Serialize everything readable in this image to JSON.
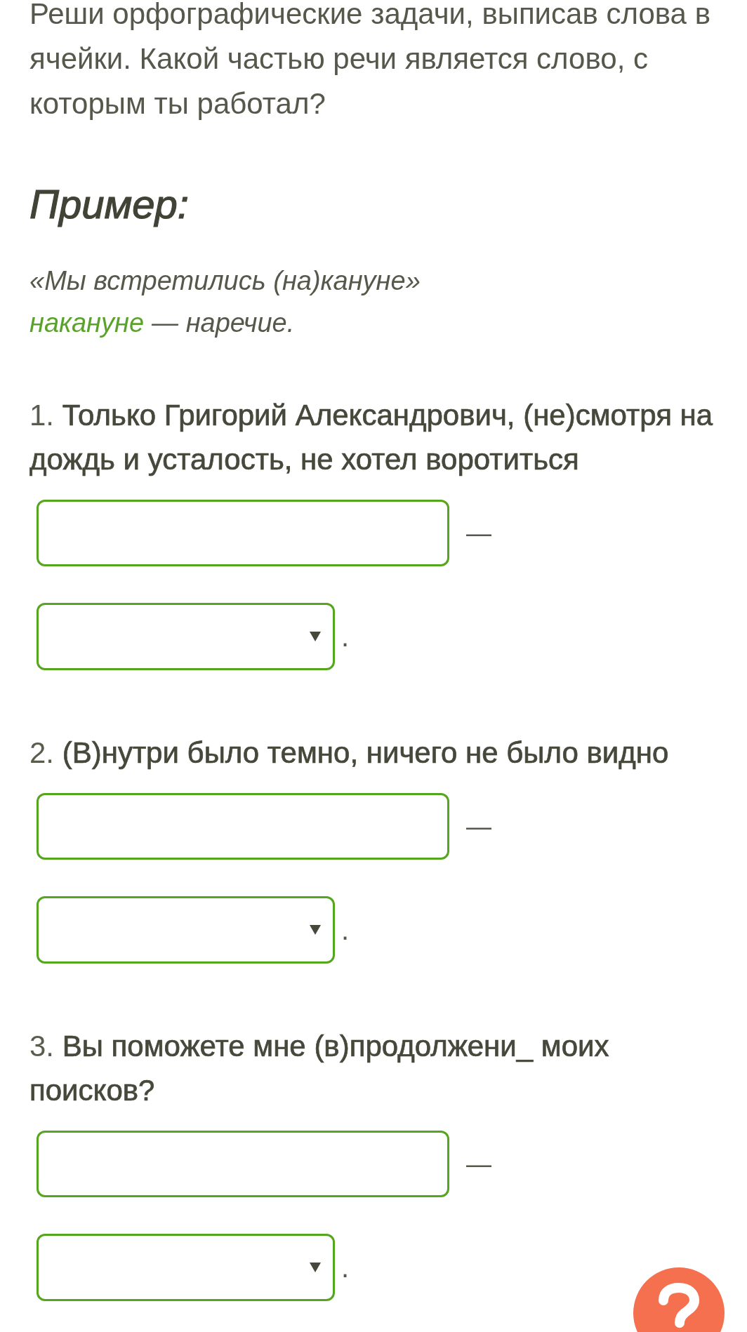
{
  "instructions": "Реши орфографические задачи, выписав слова в ячейки. Какой частью речи является слово, с которым ты работал?",
  "example": {
    "heading": "Пример:",
    "sentence": "«Мы встретились (на)кануне»",
    "answer_word": "накануне",
    "answer_rest": "— наречие."
  },
  "tasks": [
    {
      "text": "1. **Только Григорий Александрович, (не)смотря на дождь и усталость, не хотел воротиться**",
      "dash": "—",
      "period": "."
    },
    {
      "text": "2. **(В)нутри было темно, ничего не было видно**",
      "dash": "—",
      "period": "."
    },
    {
      "text": "3. **Вы поможете мне (в)продолжени_ моих поисков?**",
      "dash": "—",
      "period": "."
    }
  ]
}
